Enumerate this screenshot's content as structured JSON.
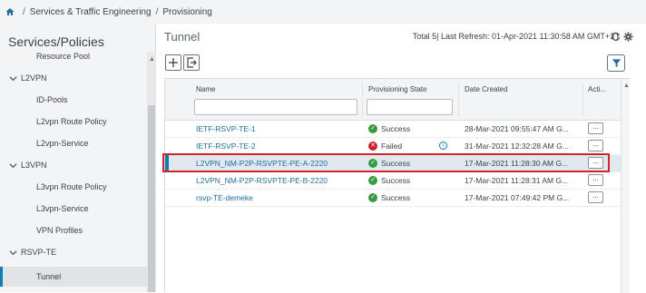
{
  "breadcrumb": {
    "items": [
      "Services & Traffic Engineering",
      "Provisioning"
    ],
    "separator": "/"
  },
  "sidebar": {
    "title": "Services/Policies",
    "cut_item": "Resource Pool",
    "groups": [
      {
        "label": "L2VPN",
        "items": [
          "ID-Pools",
          "L2vpn Route Policy",
          "L2vpn-Service"
        ]
      },
      {
        "label": "L3VPN",
        "items": [
          "L3vpn Route Policy",
          "L3vpn-Service",
          "VPN Profiles"
        ]
      },
      {
        "label": "RSVP-TE",
        "items": [
          "Tunnel"
        ]
      }
    ],
    "selected": "Tunnel"
  },
  "main": {
    "title": "Tunnel",
    "status": "Total 5| Last Refresh: 01-Apr-2021 11:30:58 AM GMT+3 |"
  },
  "table": {
    "columns": [
      "Name",
      "Provisioning State",
      "Date Created",
      "Acti..."
    ],
    "rows": [
      {
        "name": "IETF-RSVP-TE-1",
        "state": "Success",
        "date": "28-Mar-2021 09:55:47 AM G...",
        "more": "..."
      },
      {
        "name": "IETF-RSVP-TE-2",
        "state": "Failed",
        "date": "31-Mar-2021 12:32:28 AM G...",
        "more": "..."
      },
      {
        "name": "L2VPN_NM-P2P-RSVPTE-PE-A-2220",
        "state": "Success",
        "date": "17-Mar-2021 11:28:30 AM G...",
        "more": "..."
      },
      {
        "name": "L2VPN_NM-P2P-RSVPTE-PE-B-2220",
        "state": "Success",
        "date": "17-Mar-2021 11:28:31 AM G...",
        "more": "..."
      },
      {
        "name": "rsvp-TE-demeke",
        "state": "Success",
        "date": "17-Mar-2021 07:49:42 PM G...",
        "more": "..."
      }
    ],
    "selected_row": 2
  },
  "colors": {
    "accent": "#0d7eb0",
    "success": "#3a9a41",
    "failed": "#cf2030",
    "highlight": "#d2232a"
  },
  "icons": [
    "home-icon",
    "refresh-icon",
    "settings-icon",
    "add-icon",
    "export-icon",
    "filter-icon",
    "info-icon",
    "chevron-down-icon",
    "more-icon"
  ]
}
